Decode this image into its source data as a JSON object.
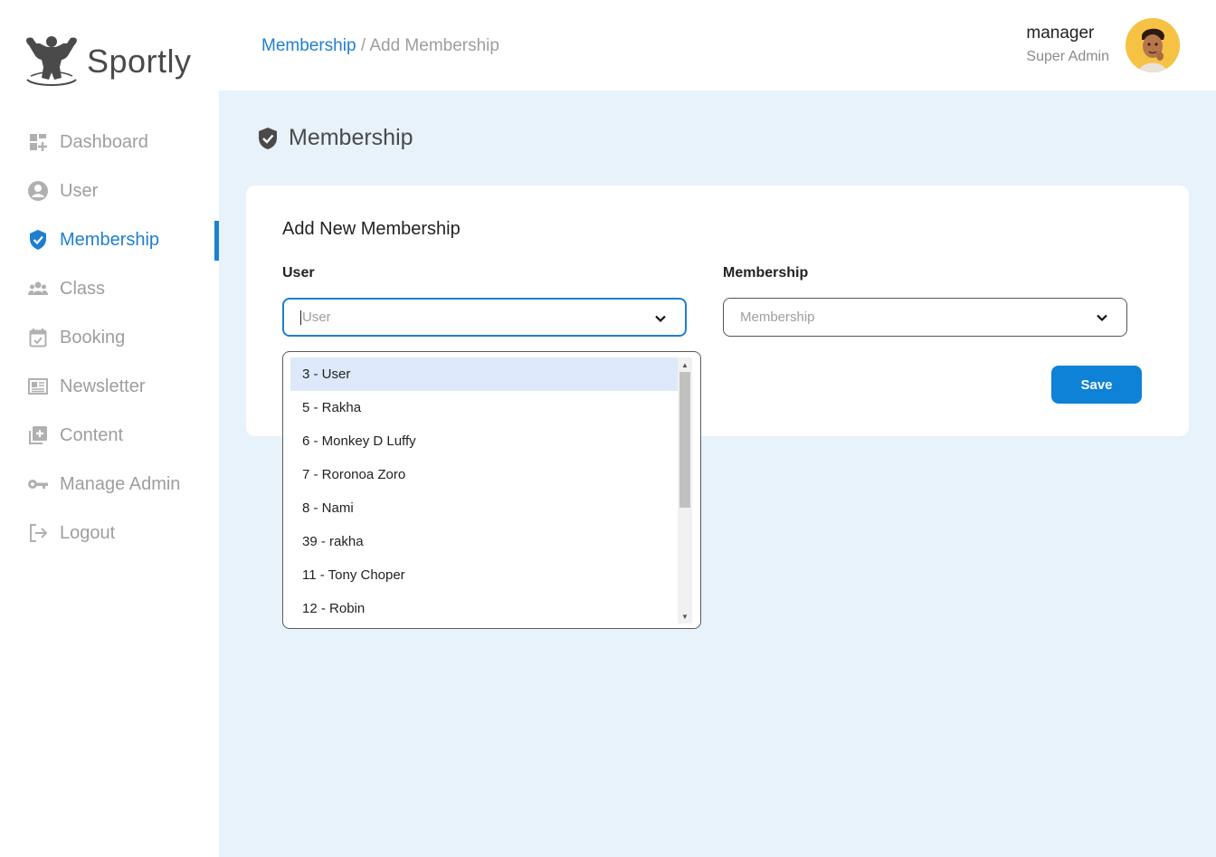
{
  "brand": {
    "name": "Sportly"
  },
  "sidebar": {
    "items": [
      {
        "label": "Dashboard",
        "icon": "dashboard-icon",
        "active": false
      },
      {
        "label": "User",
        "icon": "user-icon",
        "active": false
      },
      {
        "label": "Membership",
        "icon": "shield-check-icon",
        "active": true
      },
      {
        "label": "Class",
        "icon": "group-icon",
        "active": false
      },
      {
        "label": "Booking",
        "icon": "calendar-check-icon",
        "active": false
      },
      {
        "label": "Newsletter",
        "icon": "newspaper-icon",
        "active": false
      },
      {
        "label": "Content",
        "icon": "add-box-icon",
        "active": false
      },
      {
        "label": "Manage Admin",
        "icon": "key-icon",
        "active": false
      },
      {
        "label": "Logout",
        "icon": "logout-icon",
        "active": false
      }
    ]
  },
  "breadcrumb": {
    "parent": "Membership",
    "separator": " / ",
    "current": "Add Membership"
  },
  "header": {
    "user_name": "manager",
    "user_role": "Super Admin"
  },
  "page": {
    "title": "Membership"
  },
  "form": {
    "title": "Add New Membership",
    "user_label": "User",
    "user_placeholder": "User",
    "membership_label": "Membership",
    "membership_placeholder": "Membership",
    "save_label": "Save"
  },
  "dropdown": {
    "options": [
      "3 - User",
      "5 - Rakha",
      "6 - Monkey D Luffy",
      "7 - Roronoa Zoro",
      "8 - Nami",
      "39 - rakha",
      "11 - Tony Choper",
      "12 - Robin"
    ]
  },
  "colors": {
    "accent": "#1e7fd0",
    "main_bg": "#e7f2fb",
    "save_button": "#0d82d6",
    "highlight": "#dde9fa",
    "avatar_bg": "#f6c244"
  }
}
